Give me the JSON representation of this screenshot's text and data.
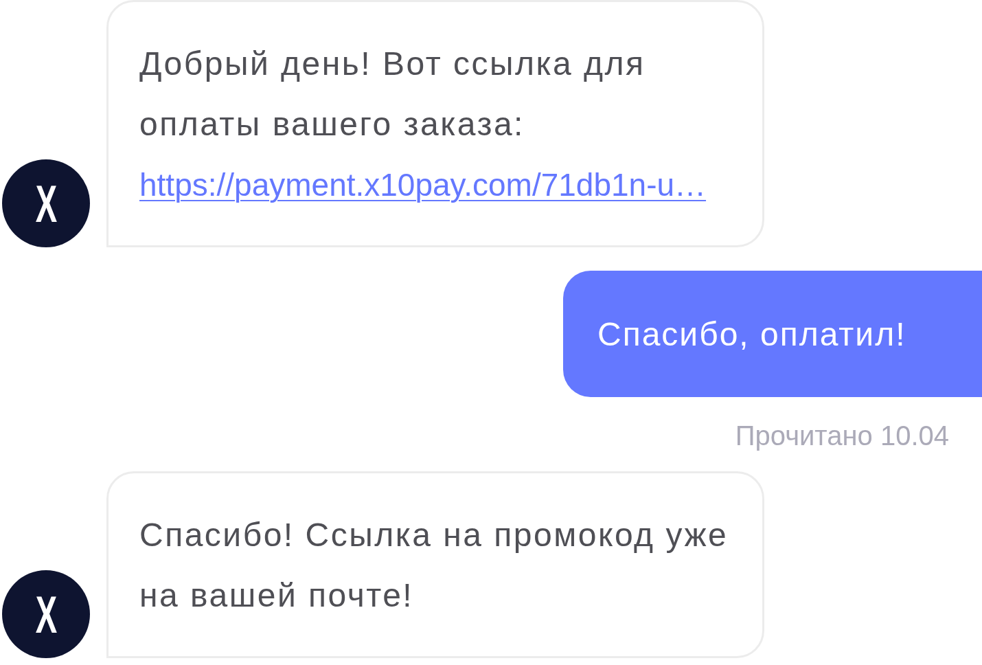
{
  "messages": [
    {
      "kind": "incoming",
      "avatar": "X",
      "text": "Добрый день! Вот ссылка для оплаты вашего заказа:",
      "link": "https://payment.x10pay.com/71db1n-u…"
    },
    {
      "kind": "outgoing",
      "text": "Спасибо, оплатил!",
      "status": "Прочитано 10.04"
    },
    {
      "kind": "incoming",
      "avatar": "X",
      "text": "Спасибо! Ссылка на промокод уже на вашей почте!"
    }
  ]
}
